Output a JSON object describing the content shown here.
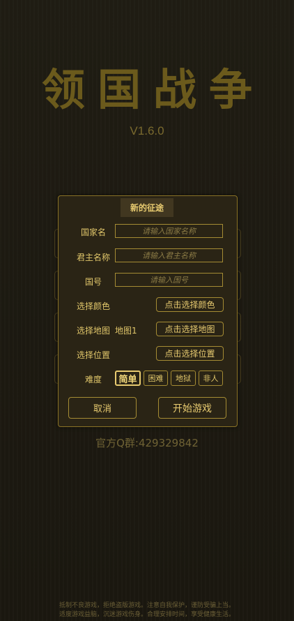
{
  "game_title": "领国战争",
  "version": "V1.6.0",
  "dialog": {
    "title": "新的征途",
    "country_name": {
      "label": "国家名",
      "placeholder": "请输入国家名称"
    },
    "monarch_name": {
      "label": "君主名称",
      "placeholder": "请输入君主名称"
    },
    "era_name": {
      "label": "国号",
      "placeholder": "请输入国号"
    },
    "color": {
      "label": "选择颜色",
      "button": "点击选择颜色"
    },
    "map": {
      "label": "选择地图",
      "value": "地图1",
      "button": "点击选择地图"
    },
    "position": {
      "label": "选择位置",
      "button": "点击选择位置"
    },
    "difficulty": {
      "label": "难度",
      "options": [
        "简单",
        "困难",
        "地狱",
        "非人"
      ],
      "selected": "简单"
    },
    "cancel_label": "取消",
    "start_label": "开始游戏"
  },
  "qq_group": "官方Q群:429329842",
  "health_notice": {
    "line1": "抵制不良游戏，拒绝盗版游戏。注意自我保护，谨防受骗上当。",
    "line2": "适度游戏益脑，沉迷游戏伤身。合理安排时间，享受健康生活。"
  },
  "colors": {
    "background": "#1d1a12",
    "gold_border": "#a58c34",
    "gold_text": "#e8cb70",
    "title_text": "#6b5a1c"
  }
}
